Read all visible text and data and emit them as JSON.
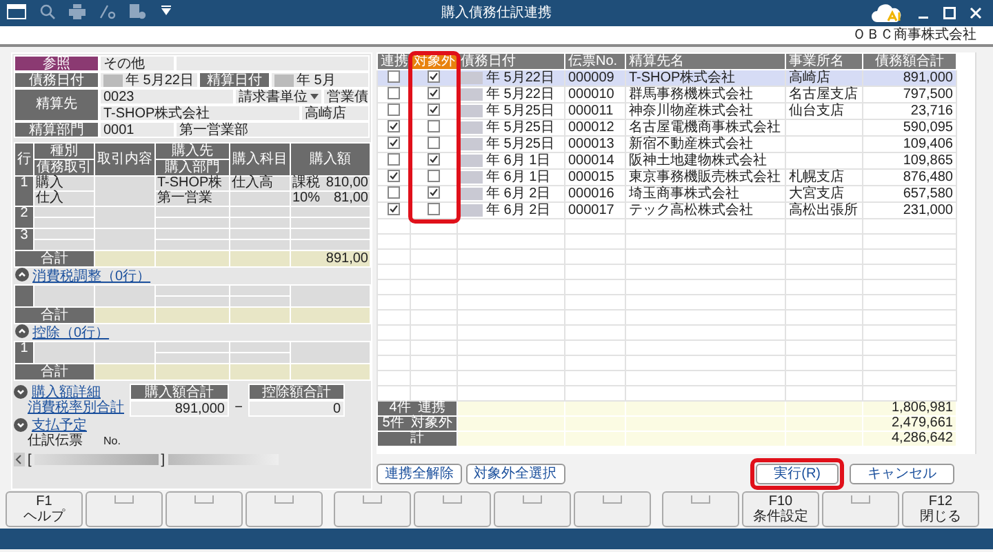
{
  "window": {
    "title": "購入債務仕訳連携",
    "company": "ＯＢＣ商事株式会社"
  },
  "voucher": {
    "reference": {
      "label": "参照",
      "value": "その他"
    },
    "debt_date": {
      "label": "債務日付",
      "value": "年 5月22日"
    },
    "settle_date": {
      "label": "精算日付",
      "value": "年 5月"
    },
    "payee": {
      "label": "精算先",
      "code": "0023",
      "unit": "請求書単位",
      "unit_next": "営業債",
      "name": "T-SHOP株式会社",
      "branch": "高崎店"
    },
    "department": {
      "label": "精算部門",
      "code": "0001",
      "name": "第一営業部"
    },
    "headers": {
      "row": "行",
      "kind_top": "種別",
      "kind_bottom": "債務取引",
      "content": "取引内容",
      "vendor_top": "購入先",
      "vendor_bottom": "購入部門",
      "account": "購入科目",
      "amount": "購入額"
    },
    "lines": [
      {
        "no": "1",
        "kind_top": "購入",
        "kind_bottom": "仕入",
        "vendor": "T-SHOP株",
        "department": "第一営業",
        "account": "仕入高",
        "tax_type": "課税",
        "amount": "810,00",
        "tax_rate": "10%",
        "tax_amount": "81,00"
      },
      {
        "no": "2"
      },
      {
        "no": "3"
      }
    ],
    "total": {
      "label": "合計",
      "amount": "891,00"
    },
    "sections": [
      {
        "title": "消費税調整（0行）",
        "expanded": true,
        "total_label": "合計"
      },
      {
        "title": "控除（0行）",
        "expanded": true,
        "row_no": "1",
        "total_label": "合計"
      }
    ],
    "summary": {
      "detail_link": "購入額詳細",
      "detail_expanded": false,
      "tax_link": "消費税率別合計",
      "purchase_label": "購入額合計",
      "purchase_value": "891,000",
      "operator": "−",
      "deduction_label": "控除額合計",
      "deduction_value": "0"
    },
    "payment": {
      "link": "支払予定",
      "expanded": false
    },
    "journal": {
      "label": "仕訳伝票",
      "no_label": "No."
    },
    "scroll": {
      "open": "[",
      "close": "]"
    }
  },
  "list": {
    "columns": [
      {
        "label": "連携",
        "highlighted": false
      },
      {
        "label": "対象外",
        "highlighted": true
      },
      {
        "label": "債務日付",
        "highlighted": false
      },
      {
        "label": "伝票No.",
        "highlighted": false
      },
      {
        "label": "精算先名",
        "highlighted": false
      },
      {
        "label": "事業所名",
        "highlighted": false
      },
      {
        "label": "債務額合計",
        "highlighted": false
      }
    ],
    "rows": [
      {
        "linked": false,
        "excluded": true,
        "date": "年 5月22日",
        "voucher_no": "000009",
        "payee": "T-SHOP株式会社",
        "office": "高崎店",
        "amount": "891,000",
        "selected": true
      },
      {
        "linked": false,
        "excluded": true,
        "date": "年 5月22日",
        "voucher_no": "000010",
        "payee": "群馬事務機株式会社",
        "office": "名古屋支店",
        "amount": "797,500",
        "selected": false
      },
      {
        "linked": false,
        "excluded": true,
        "date": "年 5月25日",
        "voucher_no": "000011",
        "payee": "神奈川物産株式会社",
        "office": "仙台支店",
        "amount": "23,716",
        "selected": false
      },
      {
        "linked": true,
        "excluded": false,
        "date": "年 5月25日",
        "voucher_no": "000012",
        "payee": "名古屋電機商事株式会社",
        "amount": "590,095",
        "selected": false
      },
      {
        "linked": true,
        "excluded": false,
        "date": "年 5月25日",
        "voucher_no": "000013",
        "payee": "新宿不動産株式会社",
        "amount": "109,406",
        "selected": false
      },
      {
        "linked": false,
        "excluded": true,
        "date": "年 6月 1日",
        "voucher_no": "000014",
        "payee": "阪神土地建物株式会社",
        "amount": "109,865",
        "selected": false
      },
      {
        "linked": true,
        "excluded": false,
        "date": "年 6月 1日",
        "voucher_no": "000015",
        "payee": "東京事務機販売株式会社",
        "office": "札幌支店",
        "amount": "876,480",
        "selected": false
      },
      {
        "linked": false,
        "excluded": true,
        "date": "年 6月 2日",
        "voucher_no": "000016",
        "payee": "埼玉商事株式会社",
        "office": "大宮支店",
        "amount": "657,580",
        "selected": false
      },
      {
        "linked": true,
        "excluded": false,
        "date": "年 6月 2日",
        "voucher_no": "000017",
        "payee": "テック高松株式会社",
        "office": "高松出張所",
        "amount": "231,000",
        "selected": false
      }
    ],
    "totals": [
      {
        "count": "4件",
        "label": "連携",
        "amount": "1,806,981"
      },
      {
        "count": "5件",
        "label": "対象外",
        "amount": "2,479,661"
      },
      {
        "label": "計",
        "amount": "4,286,642"
      }
    ],
    "bulk_buttons": [
      {
        "label": "連携全解除"
      },
      {
        "label": "対象外全選択"
      }
    ],
    "actions": [
      {
        "label": "実行(R)",
        "highlighted": true
      },
      {
        "label": "キャンセル",
        "highlighted": false
      }
    ]
  },
  "function_keys": [
    {
      "kind": "labeled",
      "key": "F1",
      "label": "ヘルプ"
    },
    {
      "kind": "blank"
    },
    {
      "kind": "blank"
    },
    {
      "kind": "blank"
    },
    {
      "kind": "blank"
    },
    {
      "kind": "blank"
    },
    {
      "kind": "blank"
    },
    {
      "kind": "blank"
    },
    {
      "kind": "blank"
    },
    {
      "kind": "labeled",
      "key": "F10",
      "label": "条件設定"
    },
    {
      "kind": "blank"
    },
    {
      "kind": "labeled",
      "key": "F12",
      "label": "閉じる"
    }
  ]
}
